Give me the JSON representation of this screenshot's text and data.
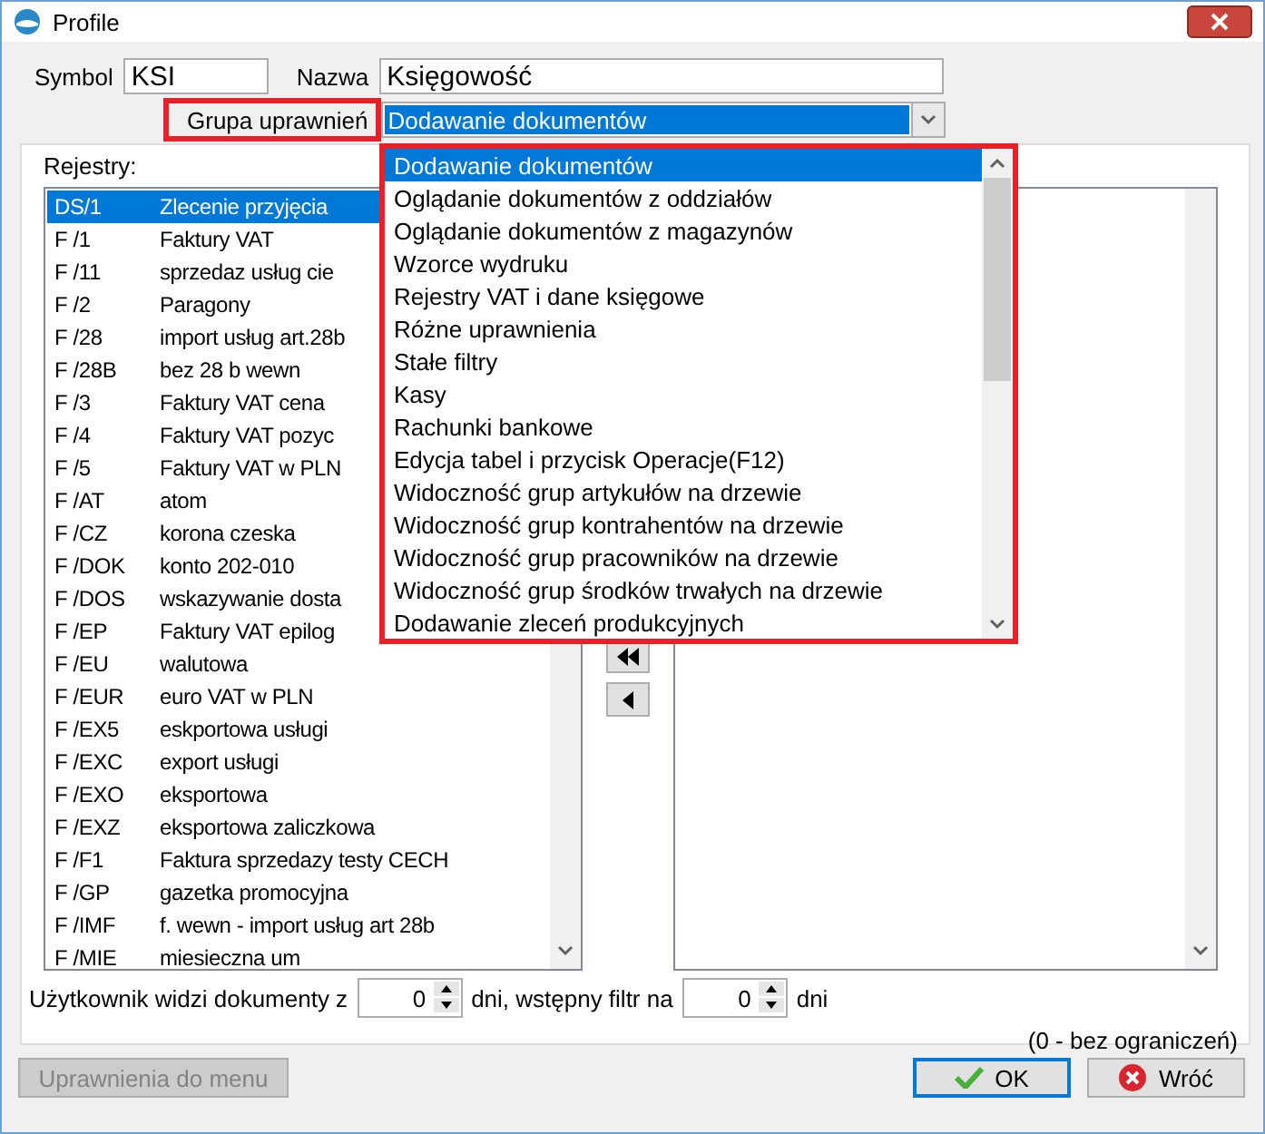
{
  "window": {
    "title": "Profile"
  },
  "symbol": {
    "label": "Symbol",
    "value": "KSI"
  },
  "name": {
    "label": "Nazwa",
    "value": "Księgowość"
  },
  "permission_group": {
    "label": "Grupa uprawnień",
    "value": "Dodawanie dokumentów",
    "open": true,
    "options": [
      {
        "label": "Dodawanie dokumentów",
        "selected": true
      },
      {
        "label": "Oglądanie dokumentów z oddziałów",
        "selected": false
      },
      {
        "label": "Oglądanie dokumentów z magazynów",
        "selected": false
      },
      {
        "label": "Wzorce wydruku",
        "selected": false
      },
      {
        "label": "Rejestry VAT i dane księgowe",
        "selected": false
      },
      {
        "label": "Różne uprawnienia",
        "selected": false
      },
      {
        "label": "Stałe filtry",
        "selected": false
      },
      {
        "label": "Kasy",
        "selected": false
      },
      {
        "label": "Rachunki bankowe",
        "selected": false
      },
      {
        "label": "Edycja tabel i przycisk Operacje(F12)",
        "selected": false
      },
      {
        "label": "Widoczność grup artykułów na drzewie",
        "selected": false
      },
      {
        "label": "Widoczność grup kontrahentów na drzewie",
        "selected": false
      },
      {
        "label": "Widoczność grup pracowników na drzewie",
        "selected": false
      },
      {
        "label": "Widoczność grup środków trwałych na drzewie",
        "selected": false
      },
      {
        "label": "Dodawanie zleceń produkcyjnych",
        "selected": false
      }
    ]
  },
  "registers": {
    "label": "Rejestry:",
    "rows": [
      {
        "code": "DS/1",
        "name": "Zlecenie przyjęcia",
        "selected": true
      },
      {
        "code": "F /1",
        "name": "Faktury VAT",
        "selected": false
      },
      {
        "code": "F /11",
        "name": "sprzedaz usług cie",
        "selected": false
      },
      {
        "code": "F /2",
        "name": "Paragony",
        "selected": false
      },
      {
        "code": "F /28",
        "name": "import usług art.28b",
        "selected": false
      },
      {
        "code": "F /28B",
        "name": "bez 28 b wewn",
        "selected": false
      },
      {
        "code": "F /3",
        "name": "Faktury VAT cena",
        "selected": false
      },
      {
        "code": "F /4",
        "name": "Faktury VAT pozyc",
        "selected": false
      },
      {
        "code": "F /5",
        "name": "Faktury VAT w PLN",
        "selected": false
      },
      {
        "code": "F /AT",
        "name": "atom",
        "selected": false
      },
      {
        "code": "F /CZ",
        "name": "korona czeska",
        "selected": false
      },
      {
        "code": "F /DOK",
        "name": "konto 202-010",
        "selected": false
      },
      {
        "code": "F /DOS",
        "name": "wskazywanie dosta",
        "selected": false
      },
      {
        "code": "F /EP",
        "name": "Faktury VAT epilog",
        "selected": false
      },
      {
        "code": "F /EU",
        "name": "walutowa",
        "selected": false
      },
      {
        "code": "F /EUR",
        "name": "euro VAT w PLN",
        "selected": false
      },
      {
        "code": "F /EX5",
        "name": "eskportowa usługi",
        "selected": false
      },
      {
        "code": "F /EXC",
        "name": "export usługi",
        "selected": false
      },
      {
        "code": "F /EXO",
        "name": "eksportowa",
        "selected": false
      },
      {
        "code": "F /EXZ",
        "name": "eksportowa zaliczkowa",
        "selected": false
      },
      {
        "code": "F /F1",
        "name": "Faktura sprzedazy testy CECH",
        "selected": false
      },
      {
        "code": "F /GP",
        "name": "gazetka promocyjna",
        "selected": false
      },
      {
        "code": "F /IMF",
        "name": "f. wewn - import usług art 28b",
        "selected": false
      },
      {
        "code": "F /MIE",
        "name": "miesieczna um",
        "selected": false
      }
    ]
  },
  "days": {
    "label_before": "Użytkownik widzi dokumenty z",
    "value": "0",
    "label_between": "dni, wstępny filtr na",
    "filter_value": "0",
    "label_after": "dni"
  },
  "note": "(0 - bez ograniczeń)",
  "buttons": [
    {
      "label": "Uprawnienia do menu",
      "kind": "menu",
      "disabled": true
    },
    {
      "label": "OK",
      "kind": "ok",
      "disabled": false
    },
    {
      "label": "Wróć",
      "kind": "back",
      "disabled": false
    }
  ]
}
